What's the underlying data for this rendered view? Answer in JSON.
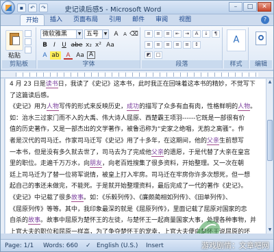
{
  "window": {
    "title": "史记读后感5 - Microsoft Word",
    "controls": [
      "–",
      "□",
      "✕"
    ]
  },
  "quick_access": [
    "save-icon",
    "undo-icon",
    "redo-icon"
  ],
  "tabs": [
    "开始",
    "插入",
    "页面布局",
    "引用",
    "邮件",
    "审阅",
    "视图"
  ],
  "ribbon": {
    "clipboard": {
      "label": "剪贴板",
      "paste_label": "粘贴"
    },
    "font": {
      "label": "字体",
      "font_name": "微软雅黑",
      "font_size": "五号",
      "row2": [
        "B",
        "I",
        "U",
        "abe",
        "x₂",
        "x²",
        "Aa"
      ],
      "row3": [
        "A",
        "ab",
        "A",
        "Aa",
        "A"
      ]
    },
    "paragraph": {
      "label": "段落"
    },
    "styles": {
      "label": "样式",
      "button_label": "A"
    },
    "editing": {
      "label": "编辑"
    }
  },
  "document": {
    "lines": [
      {
        "parts": [
          {
            "t": "4 月 23 日是"
          },
          {
            "t": "读书",
            "u": true
          },
          {
            "t": "日，我读了《史记》这本书，此时我正在回味着这本书的精妙，不觉写下"
          }
        ]
      },
      {
        "parts": [
          {
            "t": "了这篇读后感。"
          }
        ]
      },
      {
        "parts": [
          {
            "t": "《史记》用为"
          },
          {
            "t": "人物",
            "u": true
          },
          {
            "t": "写传的形式来反映历史，"
          },
          {
            "t": "成功",
            "u": true
          },
          {
            "t": "的描写了众多有血有肉，性格鲜明的"
          },
          {
            "t": "人物",
            "u": true
          },
          {
            "t": "。"
          }
        ]
      },
      {
        "parts": [
          {
            "t": "如：治水三过家门而不入的大禹、伟大诗人屈原、西楚霸王项羽------它既是一部很有价"
          }
        ]
      },
      {
        "parts": [
          {
            "t": "值的历史著作，又是一部杰出的文学著作，被鲁迅称为“史家之绝唱，无韵之离骚”。作"
          }
        ]
      },
      {
        "parts": [
          {
            "t": "者是汉代的司马迁。作家司马迁写《史记》用了十多年，在这期间，他的"
          },
          {
            "t": "父亲",
            "u": true
          },
          {
            "t": "生前想写"
          }
        ]
      },
      {
        "parts": [
          {
            "t": "一本书，但是没有多久就去世了，司马去为了完成他"
          },
          {
            "t": "父亲",
            "u": true
          },
          {
            "t": "的遗愿，于是代替了大亲在皇宫"
          }
        ]
      },
      {
        "parts": [
          {
            "t": "里的职位。走遍千万万水，向"
          },
          {
            "t": "朋友",
            "u": true
          },
          {
            "t": "，向老百姓搜集了很多资料，开始整理。又一次在朝"
          }
        ]
      },
      {
        "parts": [
          {
            "t": "廷上司马迁为了替一位将军说情，被皇上打入牢房。司马迁在牢房你许多次想死，但一想"
          }
        ]
      },
      {
        "parts": [
          {
            "t": "起自己的事还未做完，不能死。于是就开始整理资料，最后完成了一代的著作《史记》。"
          }
        ]
      },
      {
        "parts": [
          {
            "t": "《史记》中记载了很多"
          },
          {
            "t": "故事",
            "u": true
          },
          {
            "t": "。如：《乐毅列传》、《廉颇蔺相如列传》、《田单列传》、"
          }
        ]
      },
      {
        "parts": [
          {
            "t": "《屈原列传》等等。其中，我印象最深的就是《屈原列传》，里面记载了屈原对国家的忠"
          }
        ]
      },
      {
        "parts": [
          {
            "t": "自杀的"
          },
          {
            "t": "故事",
            "u": true
          },
          {
            "t": "。故事中屈原为楚怀王的左徒，与楚怀王一起商量国家大事，处理各种事物，并"
          }
        ]
      },
      {
        "parts": [
          {
            "t": "上官大夫的职位和屈原一样高，为了争夺楚怀王的宠幸，上官大夫便向楚怀王说屈原的坏"
          }
        ]
      }
    ]
  },
  "status": {
    "page": "Page: 1/1",
    "words": "Words: 660",
    "language": "English (U.S.)",
    "insert": "Insert"
  },
  "watermark": "游戏剧情：文章吧网"
}
